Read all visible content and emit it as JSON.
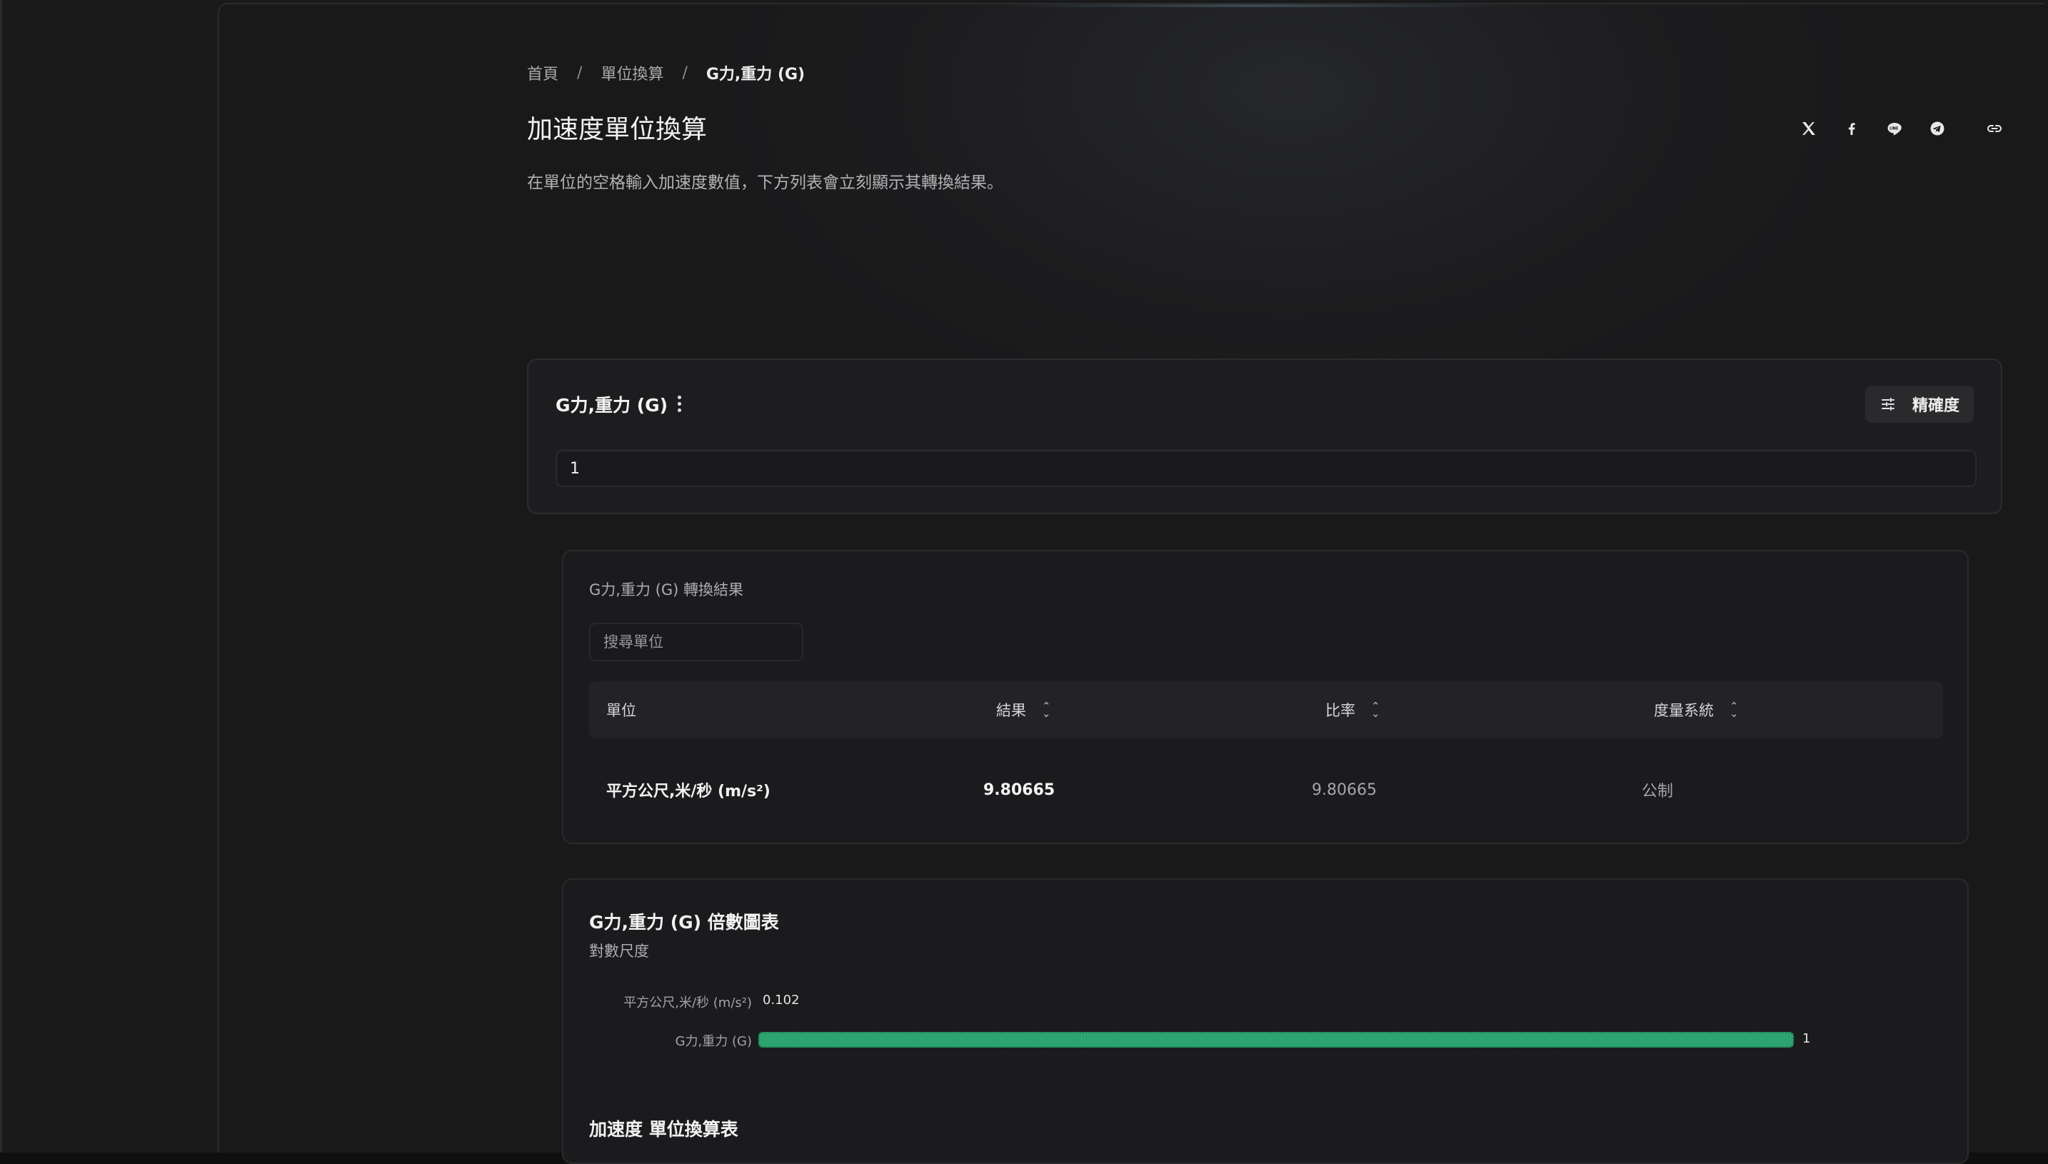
{
  "breadcrumb": {
    "home": "首頁",
    "category": "單位換算",
    "current": "G力,重力 (G)",
    "separator": "/"
  },
  "page": {
    "title": "加速度單位換算",
    "description": "在單位的空格輸入加速度數值，下方列表會立刻顯示其轉換結果。"
  },
  "share": {
    "icons": [
      "x-icon",
      "facebook-icon",
      "line-icon",
      "telegram-icon",
      "link-icon"
    ]
  },
  "input_card": {
    "unit_name": "G力,重力 (G)",
    "precision_label": "精確度",
    "value": "1"
  },
  "results": {
    "title": "G力,重力 (G) 轉換結果",
    "search_placeholder": "搜尋單位",
    "columns": {
      "unit": "單位",
      "result": "結果",
      "ratio": "比率",
      "system": "度量系統"
    },
    "rows": [
      {
        "unit": "平方公尺,米/秒 (m/s²)",
        "result": "9.80665",
        "ratio": "9.80665",
        "system": "公制"
      }
    ]
  },
  "chart": {
    "title": "G力,重力 (G) 倍數圖表",
    "subtitle": "對數尺度",
    "accent_color": "#2da36f"
  },
  "chart_data": {
    "type": "bar",
    "orientation": "horizontal",
    "scale": "log",
    "categories": [
      "平方公尺,米/秒 (m/s²)",
      "G力,重力 (G)"
    ],
    "values": [
      0.102,
      1
    ],
    "value_labels": [
      "0.102",
      "1"
    ]
  },
  "conversion_table": {
    "title": "加速度 單位換算表"
  }
}
